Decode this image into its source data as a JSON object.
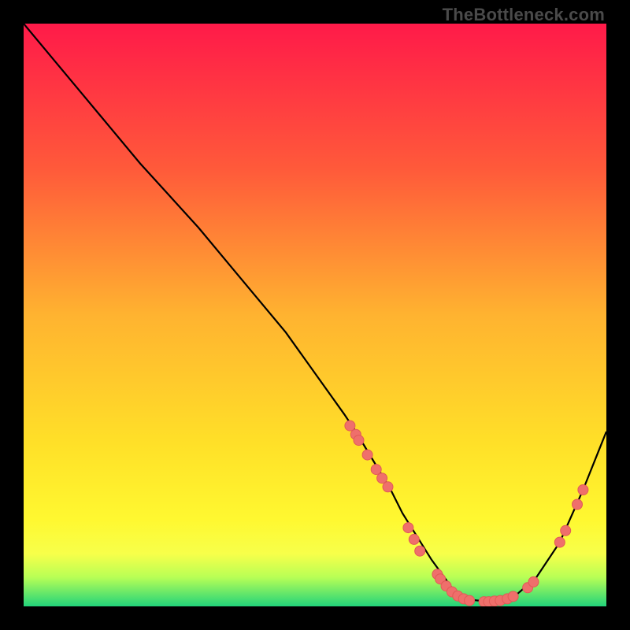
{
  "watermark": "TheBottleneck.com",
  "colors": {
    "gradient_top": "#ff1a49",
    "gradient_mid1": "#ff5a3a",
    "gradient_mid2": "#ffb330",
    "gradient_mid3": "#ffe028",
    "gradient_mid4": "#fff830",
    "gradient_band1": "#f7ff4a",
    "gradient_band2": "#b8ff55",
    "gradient_bottom": "#22d37a",
    "curve": "#000000",
    "marker_fill": "#ef6f6b",
    "marker_stroke": "#e15a57",
    "frame": "#000000"
  },
  "chart_data": {
    "type": "line",
    "title": "",
    "xlabel": "",
    "ylabel": "",
    "xlim": [
      0,
      100
    ],
    "ylim": [
      0,
      100
    ],
    "grid": false,
    "legend": false,
    "series": [
      {
        "name": "bottleneck-curve",
        "x": [
          0,
          5,
          10,
          15,
          20,
          25,
          30,
          35,
          40,
          45,
          50,
          55,
          57,
          60,
          63,
          65,
          70,
          74,
          76,
          80,
          84,
          88,
          92,
          96,
          100
        ],
        "y": [
          100,
          94,
          88,
          82,
          76,
          70.5,
          65,
          59,
          53,
          47,
          40,
          33,
          30,
          25,
          20,
          16,
          8,
          2.5,
          1.2,
          0.8,
          1.5,
          5,
          11,
          20,
          30
        ]
      }
    ],
    "markers": [
      {
        "x": 56,
        "y": 31
      },
      {
        "x": 57,
        "y": 29.5
      },
      {
        "x": 57.5,
        "y": 28.5
      },
      {
        "x": 59,
        "y": 26
      },
      {
        "x": 60.5,
        "y": 23.5
      },
      {
        "x": 61.5,
        "y": 22
      },
      {
        "x": 62.5,
        "y": 20.5
      },
      {
        "x": 66,
        "y": 13.5
      },
      {
        "x": 67,
        "y": 11.5
      },
      {
        "x": 68,
        "y": 9.5
      },
      {
        "x": 71,
        "y": 5.5
      },
      {
        "x": 71.5,
        "y": 4.7
      },
      {
        "x": 72.5,
        "y": 3.5
      },
      {
        "x": 73.5,
        "y": 2.5
      },
      {
        "x": 74.5,
        "y": 1.8
      },
      {
        "x": 75.5,
        "y": 1.3
      },
      {
        "x": 76.5,
        "y": 1.0
      },
      {
        "x": 79,
        "y": 0.8
      },
      {
        "x": 79.8,
        "y": 0.8
      },
      {
        "x": 80.8,
        "y": 0.9
      },
      {
        "x": 81.8,
        "y": 1.0
      },
      {
        "x": 83,
        "y": 1.3
      },
      {
        "x": 84,
        "y": 1.7
      },
      {
        "x": 86.5,
        "y": 3.2
      },
      {
        "x": 87.5,
        "y": 4.2
      },
      {
        "x": 92,
        "y": 11
      },
      {
        "x": 93,
        "y": 13
      },
      {
        "x": 95,
        "y": 17.5
      },
      {
        "x": 96,
        "y": 20
      }
    ]
  }
}
